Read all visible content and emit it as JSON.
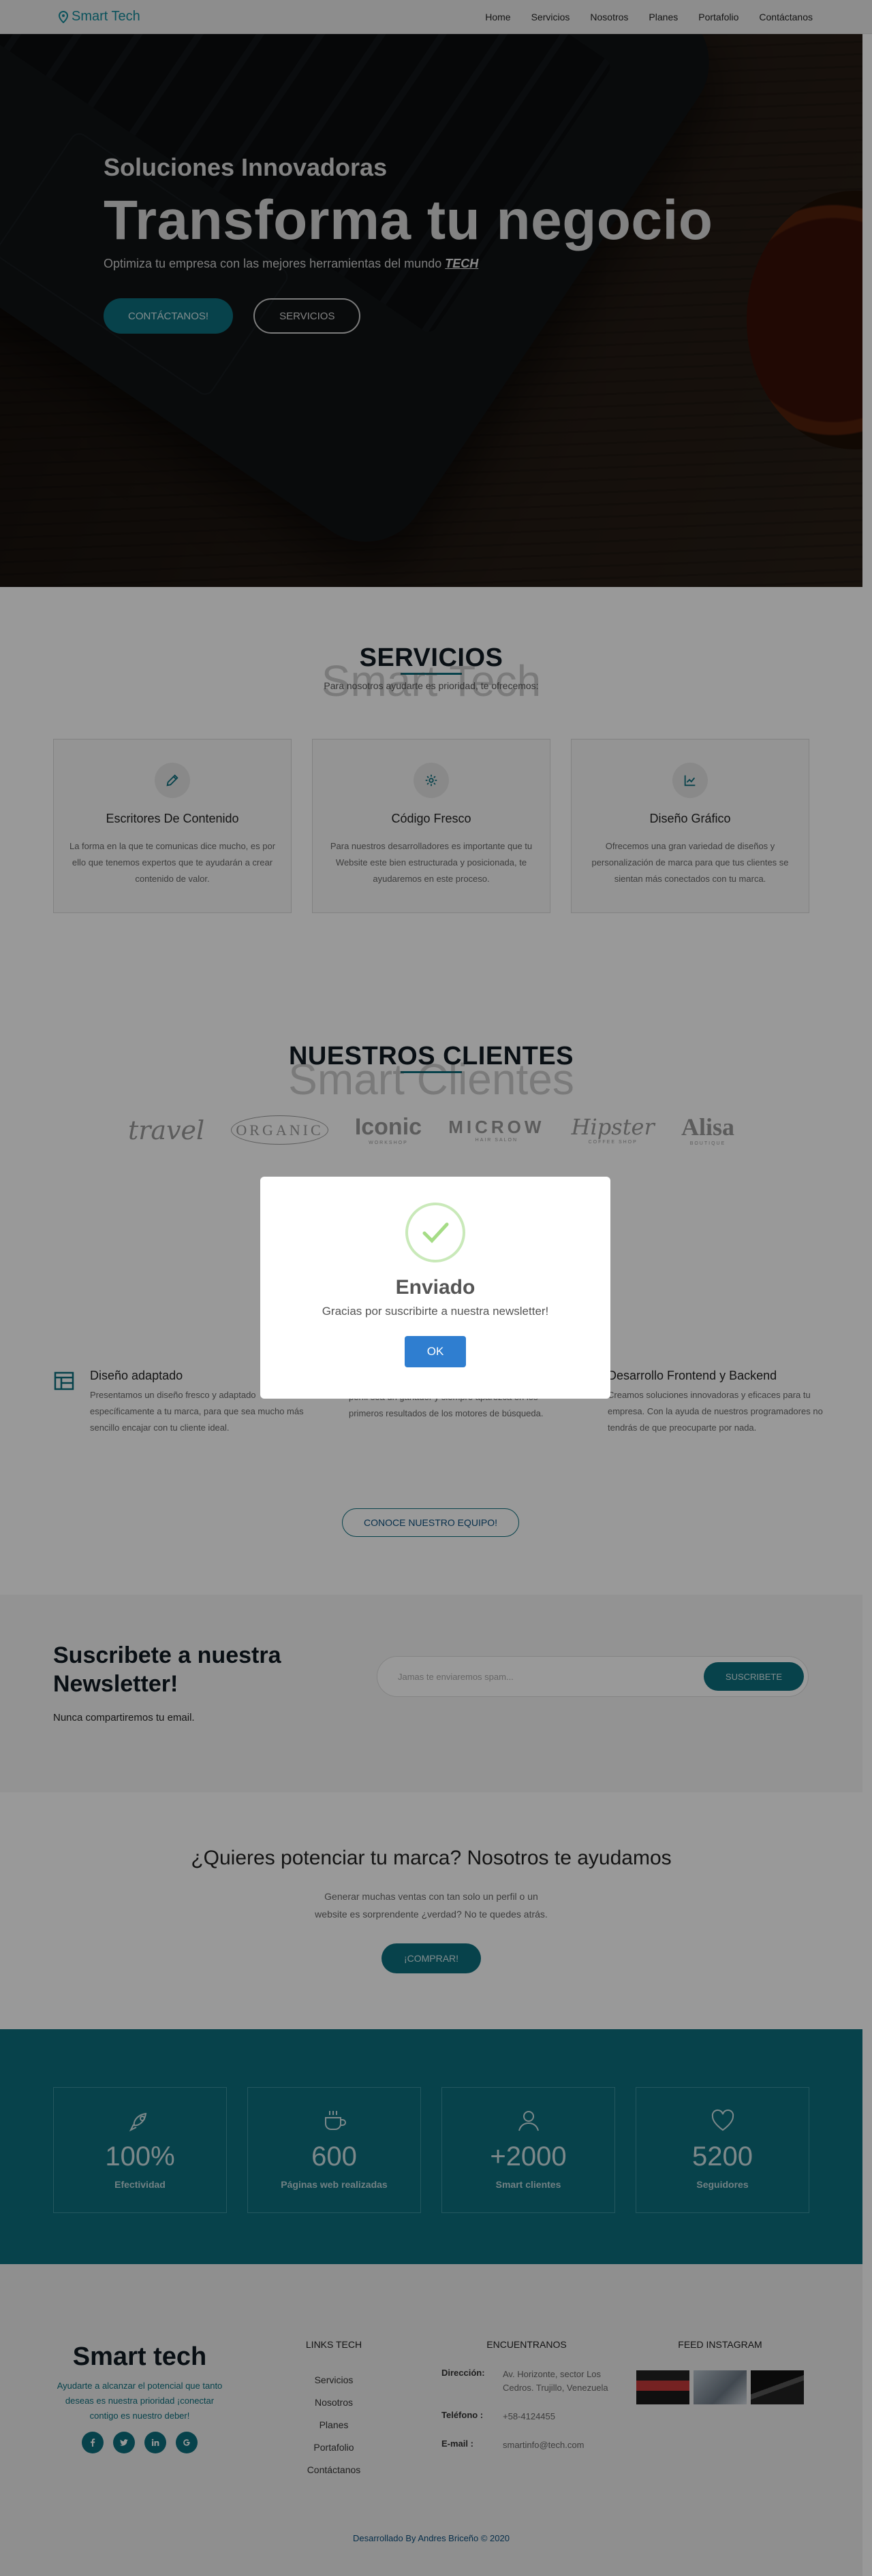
{
  "nav": {
    "brand": "Smart Tech",
    "items": [
      "Home",
      "Servicios",
      "Nosotros",
      "Planes",
      "Portafolio",
      "Contáctanos"
    ]
  },
  "hero": {
    "kicker": "Soluciones Innovadoras",
    "title": "Transforma tu negocio",
    "subtitle": "Optimiza tu empresa con las mejores herramientas del mundo",
    "subtitle_strong": "TECH",
    "cta_primary": "CONTÁCTANOS!",
    "cta_secondary": "SERVICIOS"
  },
  "services": {
    "ghost": "Smart Tech",
    "title": "SERVICIOS",
    "subtitle": "Para nosotros ayudarte es prioridad, te ofrecemos:",
    "cards": [
      {
        "icon": "pencil-icon",
        "title": "Escritores De Contenido",
        "text": "La forma en la que te comunicas dice mucho, es por ello que tenemos expertos que te ayudarán a crear contenido de valor."
      },
      {
        "icon": "gear-icon",
        "title": "Código Fresco",
        "text": "Para nuestros desarrolladores es importante que tu Website este bien estructurada y posicionada, te ayudaremos en este proceso."
      },
      {
        "icon": "chart-icon",
        "title": "Diseño Gráfico",
        "text": "Ofrecemos una gran variedad de diseños y personalización de marca para que tus clientes se sientan más conectados con tu marca."
      }
    ]
  },
  "clients": {
    "ghost": "Smart Clientes",
    "title": "NUESTROS CLIENTES",
    "logos": [
      {
        "name": "travel",
        "sub": ""
      },
      {
        "name": "ORGANIC",
        "sub": ""
      },
      {
        "name": "Iconic",
        "sub": "WORKSHOP"
      },
      {
        "name": "MICROW",
        "sub": "HAIR SALON"
      },
      {
        "name": "Hipster",
        "sub": "COFFEE SHOP"
      },
      {
        "name": "Alisa",
        "sub": "BOUTIQUE"
      }
    ]
  },
  "features": [
    {
      "title": "Diseño adaptado",
      "text": "Presentamos un diseño fresco y adaptado específicamente a tu marca, para que sea mucho más sencillo encajar con tu cliente ideal."
    },
    {
      "title": "",
      "text": "Contamos con las mejores herramientas para que tu perfil sea un ganador y siempre aparezca en los primeros resultados de los motores de búsqueda."
    },
    {
      "title": "Desarrollo Frontend y Backend",
      "text": "Creamos soluciones innovadoras y eficaces para tu empresa. Con la ayuda de nuestros programadores no tendrás de que preocuparte por nada."
    }
  ],
  "team_button": "CONOCE NUESTRO EQUIPO!",
  "newsletter": {
    "title": "Suscribete a nuestra Newsletter!",
    "note": "Nunca compartiremos tu email.",
    "placeholder": "Jamas te enviaremos spam...",
    "button": "SUSCRIBETE"
  },
  "cta": {
    "title": "¿Quieres potenciar tu marca? Nosotros te ayudamos",
    "text": "Generar muchas ventas con tan solo un perfil o un website es sorprendente ¿verdad? No te quedes atrás.",
    "button": "¡COMPRAR!"
  },
  "stats": [
    {
      "icon": "rocket-icon",
      "value": "100%",
      "label": "Efectividad"
    },
    {
      "icon": "coffee-icon",
      "value": "600",
      "label": "Páginas web realizadas"
    },
    {
      "icon": "user-icon",
      "value": "+2000",
      "label": "Smart clientes"
    },
    {
      "icon": "heart-icon",
      "value": "5200",
      "label": "Seguidores"
    }
  ],
  "footer": {
    "brand": "Smart tech",
    "tagline": "Ayudarte a alcanzar el potencial que tanto deseas es nuestra prioridad ¡conectar contigo es nuestro deber!",
    "links_title": "LINKS TECH",
    "links": [
      "Servicios",
      "Nosotros",
      "Planes",
      "Portafolio",
      "Contáctanos"
    ],
    "contact_title": "ENCUENTRANOS",
    "address_label": "Dirección:",
    "address": "Av. Horizonte, sector Los Cedros. Trujillo, Venezuela",
    "phone_label": "Teléfono :",
    "phone": "+58-4124455",
    "email_label": "E-mail :",
    "email": "smartinfo@tech.com",
    "insta_title": "FEED INSTAGRAM",
    "copyright": "Desarrollado By Andres Briceño © 2020"
  },
  "modal": {
    "title": "Enviado",
    "message": "Gracias por suscribirte a nuestra newsletter!",
    "button": "OK"
  },
  "colors": {
    "accent": "#13899a",
    "accent_dark": "#0c6f7e",
    "ok_button": "#2f7ed0",
    "success": "#a5dc86"
  }
}
